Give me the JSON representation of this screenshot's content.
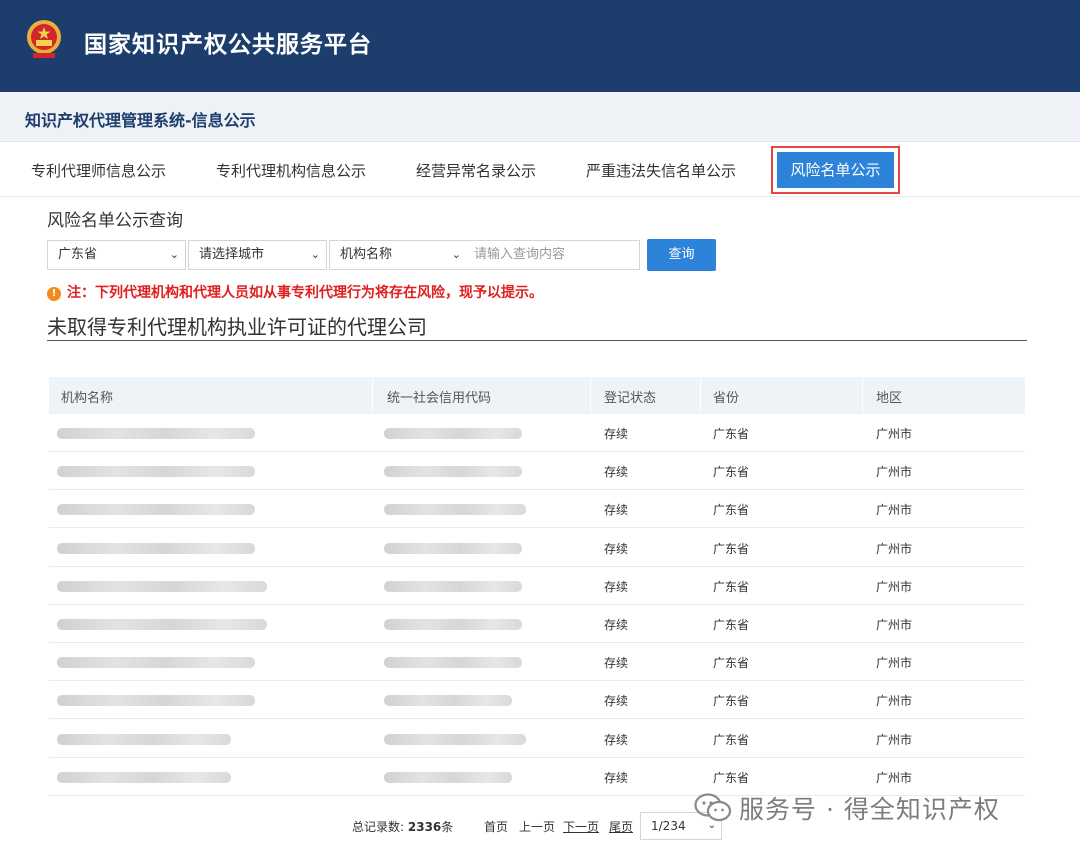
{
  "header": {
    "site_title": "国家知识产权公共服务平台"
  },
  "subheader": {
    "system_title": "知识产权代理管理系统-信息公示"
  },
  "tabs": [
    {
      "label": "专利代理师信息公示"
    },
    {
      "label": "专利代理机构信息公示"
    },
    {
      "label": "经营异常名录公示"
    },
    {
      "label": "严重违法失信名单公示"
    },
    {
      "label": "风险名单公示",
      "active": true
    }
  ],
  "query": {
    "title": "风险名单公示查询",
    "province_select": "广东省",
    "city_select": "请选择城市",
    "field_select": "机构名称",
    "search_placeholder": "请输入查询内容",
    "query_button": "查询"
  },
  "notice": "注：下列代理机构和代理人员如从事专利代理行为将存在风险，现予以提示。",
  "section_title": "未取得专利代理机构执业许可证的代理公司",
  "table": {
    "headers": [
      "机构名称",
      "统一社会信用代码",
      "登记状态",
      "省份",
      "地区"
    ],
    "rows": [
      {
        "status": "存续",
        "province": "广东省",
        "region": "广州市"
      },
      {
        "status": "存续",
        "province": "广东省",
        "region": "广州市"
      },
      {
        "status": "存续",
        "province": "广东省",
        "region": "广州市"
      },
      {
        "status": "存续",
        "province": "广东省",
        "region": "广州市"
      },
      {
        "status": "存续",
        "province": "广东省",
        "region": "广州市"
      },
      {
        "status": "存续",
        "province": "广东省",
        "region": "广州市"
      },
      {
        "status": "存续",
        "province": "广东省",
        "region": "广州市"
      },
      {
        "status": "存续",
        "province": "广东省",
        "region": "广州市"
      },
      {
        "status": "存续",
        "province": "广东省",
        "region": "广州市"
      },
      {
        "status": "存续",
        "province": "广东省",
        "region": "广州市"
      }
    ]
  },
  "pager": {
    "total_label": "总记录数:",
    "total": "2336",
    "total_unit": "条",
    "first": "首页",
    "prev": "上一页",
    "next": "下一页",
    "last": "尾页",
    "page": "1/234"
  },
  "watermark": "服务号 · 得全知识产权",
  "colors": {
    "header_bg": "#1d3d6c",
    "accent": "#2d83d9",
    "warning": "#e01f1f",
    "highlight_border": "#e64545"
  },
  "icons": [
    "national-emblem-icon",
    "chevron-down-icon",
    "warning-icon",
    "wechat-icon"
  ]
}
